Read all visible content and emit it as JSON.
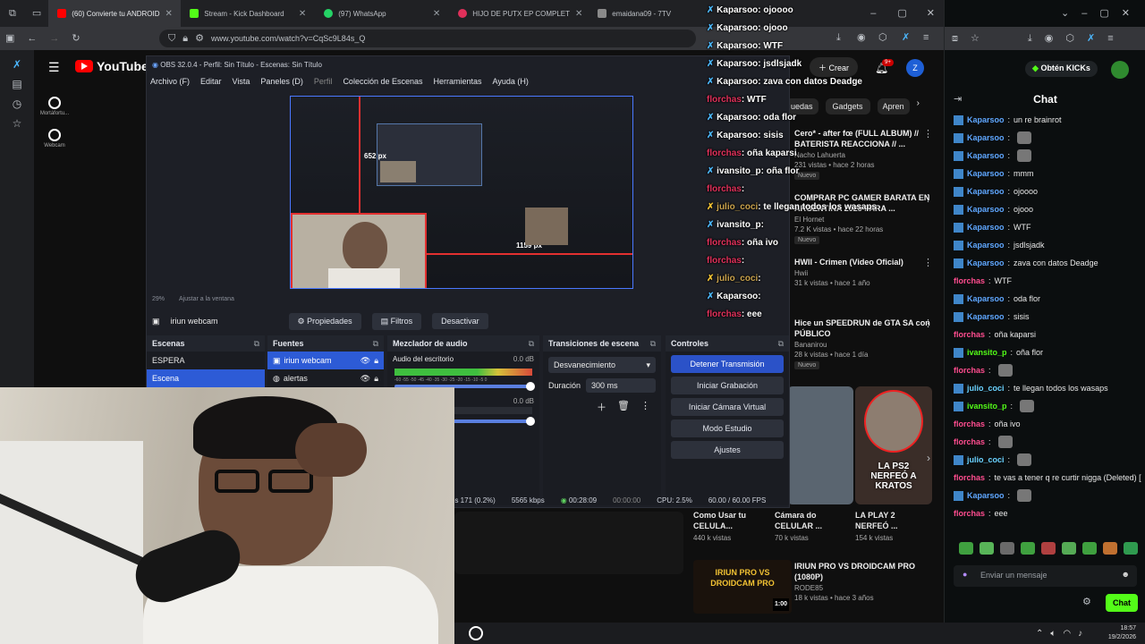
{
  "browser": {
    "tabs": [
      {
        "label": "(60) Convierte tu ANDROID",
        "active": true,
        "icon": "youtube-icon",
        "color": "#ff0000"
      },
      {
        "label": "Stream - Kick Dashboard",
        "icon": "kick-icon",
        "color": "#53fc18"
      },
      {
        "label": "(97) WhatsApp",
        "icon": "whatsapp-icon",
        "color": "#25d366"
      },
      {
        "label": "HIJO DE PUTX EP COMPLET",
        "icon": "music-icon",
        "color": "#e0305a"
      },
      {
        "label": "emaidana09 - 7TV",
        "icon": "7tv-icon",
        "color": "#8a8a8a"
      }
    ],
    "url": "www.youtube.com/watch?v=CqSc9L84s_Q"
  },
  "youtube": {
    "logo": "YouTube",
    "logo_region": "AR",
    "create_label": "Crear",
    "notif_count": "9+",
    "avatar_letter": "Z",
    "nav": [
      "Mortáfortu...",
      "Webcam"
    ],
    "chips": [
      "uedas",
      "Gadgets",
      "Apren"
    ]
  },
  "obs": {
    "title": "OBS 32.0.4 - Perfil: Sin Título - Escenas: Sin Título",
    "menu": [
      "Archivo (F)",
      "Editar",
      "Vista",
      "Paneles (D)",
      "Perfil",
      "Colección de Escenas",
      "Herramientas",
      "Ayuda (H)"
    ],
    "preview_labels": {
      "px1": "652 px",
      "px2": "1159 px"
    },
    "zoom": "29%",
    "fit_label": "Ajustar a la ventana",
    "selected_source": "iriun webcam",
    "btn_props": "Propiedades",
    "btn_filters": "Filtros",
    "btn_deactivate": "Desactivar",
    "docks": {
      "scenes": {
        "title": "Escenas",
        "items": [
          "ESPERA",
          "Escena"
        ]
      },
      "sources": {
        "title": "Fuentes",
        "items": [
          "iriun webcam",
          "alertas"
        ]
      },
      "mixer": {
        "title": "Mezclador de audio",
        "channel": "Audio del escritorio",
        "db1": "0.0 dB",
        "db2": "0.0 dB",
        "scale": "-60 -55 -50 -45 -40 -35 -30 -25 -20 -15 -10 -5 0"
      },
      "transitions": {
        "title": "Transiciones de escena",
        "type": "Desvanecimiento",
        "duration_label": "Duración",
        "duration": "300 ms"
      },
      "controls": {
        "title": "Controles",
        "buttons": [
          "Detener Transmisión",
          "Iniciar Grabación",
          "Iniciar Cámara Virtual",
          "Modo Estudio",
          "Ajustes"
        ]
      }
    },
    "status": {
      "frames": "os 171 (0.2%)",
      "bitrate": "5565 kbps",
      "live_time": "00:28:09",
      "rec_time": "00:00:00",
      "cpu": "CPU: 2.5%",
      "fps": "60.00 / 60.00 FPS"
    }
  },
  "overlay_chat": [
    {
      "user": "Kaparsoo",
      "msg": "ojoooo",
      "style": "u"
    },
    {
      "user": "Kaparsoo",
      "msg": "ojooo",
      "style": "u"
    },
    {
      "user": "Kaparsoo",
      "msg": "WTF",
      "style": "u"
    },
    {
      "user": "Kaparsoo",
      "msg": "jsdlsjadk",
      "style": "u"
    },
    {
      "user": "Kaparsoo",
      "msg": "zava con datos Deadge",
      "style": "u"
    },
    {
      "user": "florchas",
      "msg": "WTF",
      "style": "r"
    },
    {
      "user": "Kaparsoo",
      "msg": "oda flor",
      "style": "u"
    },
    {
      "user": "Kaparsoo",
      "msg": "sisis",
      "style": "u"
    },
    {
      "user": "florchas",
      "msg": "oña kaparsi",
      "style": "r"
    },
    {
      "user": "ivansito_p",
      "msg": "oña flor",
      "style": "u"
    },
    {
      "user": "florchas",
      "msg": "",
      "style": "r"
    },
    {
      "user": "julio_coci",
      "msg": "te llegan todos los wasaps",
      "style": "g"
    },
    {
      "user": "ivansito_p",
      "msg": "",
      "style": "u"
    },
    {
      "user": "florchas",
      "msg": "oña ivo",
      "style": "r"
    },
    {
      "user": "florchas",
      "msg": "",
      "style": "r"
    },
    {
      "user": "julio_coci",
      "msg": "",
      "style": "g"
    },
    {
      "user": "Kaparsoo",
      "msg": "",
      "style": "u"
    },
    {
      "user": "florchas",
      "msg": "eee",
      "style": "r"
    }
  ],
  "recommendations": [
    {
      "title": "Cero* - after fœ (FULL ALBUM) // BATERISTA REACCIONA // ...",
      "channel": "Nacho Lahuerta",
      "meta": "231 vistas • hace 2 horas",
      "badge": "Nuevo"
    },
    {
      "title": "COMPRAR PC GAMER BARATA EN ARGENTINA 2025 PARA ...",
      "channel": "El Hornet",
      "meta": "7.2 K vistas • hace 22 horas",
      "badge": "Nuevo"
    },
    {
      "title": "HWII - Crimen (Video Oficial)",
      "channel": "Hwii",
      "meta": "31 k vistas • hace 1 año",
      "badge": ""
    },
    {
      "title": "Hice un SPEEDRUN de GTA SA con PÚBLICO",
      "channel": "Bananirou",
      "meta": "28 k vistas • hace 1 día",
      "badge": "Nuevo"
    }
  ],
  "shorts": [
    {
      "title": "Como Usar tu CELULA...",
      "meta": "440 k vistas"
    },
    {
      "title": "Cámara do CELULAR ...",
      "meta": "70 k vistas"
    },
    {
      "title": "LA PLAY 2 NERFEÓ ...",
      "meta": "154 k vistas",
      "overlay": "LA PS2 NERFEÓ A KRATOS"
    }
  ],
  "bottom_video": {
    "title": "IRIUN PRO VS DROIDCAM PRO (1080P)",
    "channel": "RODE85",
    "meta": "18 k vistas • hace 3 años",
    "duration": "1:00",
    "thumb_text": "IRIUN PRO VS DROIDCAM PRO"
  },
  "kick": {
    "obtain_label": "Obtén KICKs",
    "chat_title": "Chat",
    "messages": [
      {
        "user": "Kaparsoo",
        "msg": "un re brainrot",
        "cls": "u1"
      },
      {
        "user": "Kaparsoo",
        "msg": "",
        "cls": "u1"
      },
      {
        "user": "Kaparsoo",
        "msg": "",
        "cls": "u1"
      },
      {
        "user": "Kaparsoo",
        "msg": "mmm",
        "cls": "u1"
      },
      {
        "user": "Kaparsoo",
        "msg": "ojoooo",
        "cls": "u1"
      },
      {
        "user": "Kaparsoo",
        "msg": "ojooo",
        "cls": "u1"
      },
      {
        "user": "Kaparsoo",
        "msg": "WTF",
        "cls": "u1"
      },
      {
        "user": "Kaparsoo",
        "msg": "jsdlsjadk",
        "cls": "u1"
      },
      {
        "user": "Kaparsoo",
        "msg": "zava con datos Deadge",
        "cls": "u1"
      },
      {
        "user": "florchas",
        "msg": "WTF",
        "cls": "u2"
      },
      {
        "user": "Kaparsoo",
        "msg": "oda flor",
        "cls": "u1"
      },
      {
        "user": "Kaparsoo",
        "msg": "sisis",
        "cls": "u1"
      },
      {
        "user": "florchas",
        "msg": "oña kaparsi",
        "cls": "u2"
      },
      {
        "user": "ivansito_p",
        "msg": "oña flor",
        "cls": "u3"
      },
      {
        "user": "florchas",
        "msg": "",
        "cls": "u2"
      },
      {
        "user": "julio_coci",
        "msg": "te llegan todos los wasaps",
        "cls": "u4"
      },
      {
        "user": "ivansito_p",
        "msg": "",
        "cls": "u3"
      },
      {
        "user": "florchas",
        "msg": "oña ivo",
        "cls": "u2"
      },
      {
        "user": "florchas",
        "msg": "",
        "cls": "u2"
      },
      {
        "user": "julio_coci",
        "msg": "",
        "cls": "u4"
      },
      {
        "user": "florchas",
        "msg": "te vas a tener q re curtir nigga (Deleted) [odio]",
        "cls": "u2"
      },
      {
        "user": "Kaparsoo",
        "msg": "",
        "cls": "u1"
      },
      {
        "user": "florchas",
        "msg": "eee",
        "cls": "u2"
      }
    ],
    "input_placeholder": "Enviar un mensaje",
    "send_label": "Chat"
  },
  "taskbar": {
    "time": "18:57",
    "date": "19/2/2026"
  }
}
